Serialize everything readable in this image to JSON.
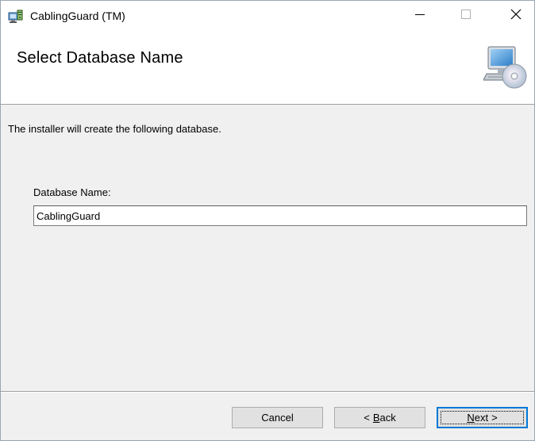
{
  "window": {
    "title": "CablingGuard (TM)",
    "controls": {
      "minimize": "minimize-icon",
      "maximize": "maximize-icon",
      "close": "close-icon"
    }
  },
  "header": {
    "title": "Select Database Name",
    "icon": "computer-cd-icon"
  },
  "body": {
    "intro": "The installer will create the following database.",
    "database_label": "Database Name:",
    "database_value": "CablingGuard"
  },
  "buttons": {
    "cancel": "Cancel",
    "back_mnemonic": "B",
    "back_rest": "ack",
    "back_prefix": "<",
    "next_mnemonic": "N",
    "next_rest": "ext",
    "next_suffix": ">"
  },
  "colors": {
    "accent": "#0078d7",
    "window_bg": "#f0f0f0",
    "button_bg": "#e1e1e1"
  }
}
